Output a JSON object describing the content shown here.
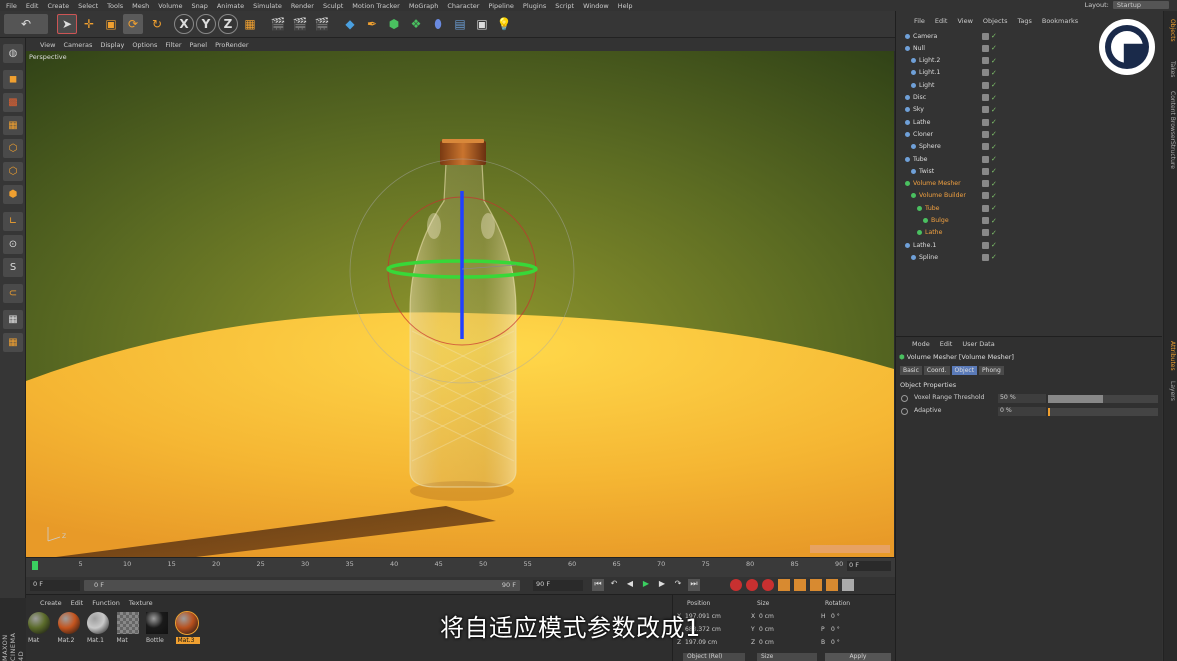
{
  "menubar": {
    "items": [
      "File",
      "Edit",
      "Create",
      "Select",
      "Tools",
      "Mesh",
      "Volume",
      "Snap",
      "Animate",
      "Simulate",
      "Render",
      "Sculpt",
      "Motion Tracker",
      "MoGraph",
      "Character",
      "Pipeline",
      "Plugins",
      "Script",
      "Window",
      "Help"
    ],
    "layout_label": "Layout:",
    "layout_value": "Startup"
  },
  "viewport": {
    "menu": [
      "View",
      "Cameras",
      "Display",
      "Options",
      "Filter",
      "Panel",
      "ProRender"
    ],
    "label": "Perspective",
    "axis_z": "Z"
  },
  "timeline": {
    "ticks": [
      "0",
      "5",
      "10",
      "15",
      "20",
      "25",
      "30",
      "35",
      "40",
      "45",
      "50",
      "55",
      "60",
      "65",
      "70",
      "75",
      "80",
      "85",
      "90"
    ],
    "end_frame": "0 F",
    "current": "0 F",
    "start_field": "0 F",
    "range_end": "90 F",
    "max_field": "90 F"
  },
  "materials": {
    "menu": [
      "Create",
      "Edit",
      "Function",
      "Texture"
    ],
    "items": [
      {
        "label": "Mat",
        "color": "#5b6b2a"
      },
      {
        "label": "Mat.2",
        "color": "#c4541e"
      },
      {
        "label": "Mat.1",
        "color": "#c9c9c9"
      },
      {
        "label": "Mat",
        "color": "#7a7a7a"
      },
      {
        "label": "Bottle",
        "color": "#1a1a1a"
      },
      {
        "label": "Mat.3",
        "color": "#b8501d"
      }
    ]
  },
  "coordinates": {
    "headers": [
      "Position",
      "Size",
      "Rotation"
    ],
    "rows": [
      {
        "axis": "X",
        "pos": "197.091 cm",
        "size_axis": "X",
        "size": "0 cm",
        "rot_axis": "H",
        "rot": "0 °"
      },
      {
        "axis": "Y",
        "pos": "683.372 cm",
        "size_axis": "Y",
        "size": "0 cm",
        "rot_axis": "P",
        "rot": "0 °"
      },
      {
        "axis": "Z",
        "pos": "197.09 cm",
        "size_axis": "Z",
        "size": "0 cm",
        "rot_axis": "B",
        "rot": "0 °"
      }
    ],
    "mode_select": "Object (Rel)",
    "size_select": "Size",
    "apply": "Apply"
  },
  "objects": {
    "menu": [
      "File",
      "Edit",
      "View",
      "Objects",
      "Tags",
      "Bookmarks"
    ],
    "tree": [
      {
        "name": "Camera",
        "indent": 0,
        "color": "#ddd"
      },
      {
        "name": "Null",
        "indent": 0,
        "color": "#ddd"
      },
      {
        "name": "Light.2",
        "indent": 1,
        "color": "#ddd"
      },
      {
        "name": "Light.1",
        "indent": 1,
        "color": "#ddd"
      },
      {
        "name": "Light",
        "indent": 1,
        "color": "#ddd"
      },
      {
        "name": "Disc",
        "indent": 0,
        "color": "#ddd"
      },
      {
        "name": "Sky",
        "indent": 0,
        "color": "#ddd"
      },
      {
        "name": "Lathe",
        "indent": 0,
        "color": "#ddd"
      },
      {
        "name": "Cloner",
        "indent": 0,
        "color": "#ddd"
      },
      {
        "name": "Sphere",
        "indent": 1,
        "color": "#ddd"
      },
      {
        "name": "Tube",
        "indent": 0,
        "color": "#ddd"
      },
      {
        "name": "Twist",
        "indent": 1,
        "color": "#ddd"
      },
      {
        "name": "Volume Mesher",
        "indent": 0,
        "color": "#f0a040"
      },
      {
        "name": "Volume Builder",
        "indent": 1,
        "color": "#f0a040"
      },
      {
        "name": "Tube",
        "indent": 2,
        "color": "#f0a040"
      },
      {
        "name": "Bulge",
        "indent": 3,
        "color": "#f0a040"
      },
      {
        "name": "Lathe",
        "indent": 2,
        "color": "#f0a040"
      },
      {
        "name": "Lathe.1",
        "indent": 0,
        "color": "#ddd"
      },
      {
        "name": "Spline",
        "indent": 1,
        "color": "#ddd"
      }
    ]
  },
  "sidetabs": [
    "Objects",
    "Takes",
    "Content Browser",
    "Structure",
    "Attributes",
    "Layers"
  ],
  "attributes": {
    "menu": [
      "Mode",
      "Edit",
      "User Data"
    ],
    "title": "Volume Mesher [Volume Mesher]",
    "tabs": [
      "Basic",
      "Coord.",
      "Object",
      "Phong"
    ],
    "active_tab": "Object",
    "section": "Object Properties",
    "params": [
      {
        "label": "Voxel Range Threshold",
        "value": "50 %",
        "fraction": 0.5
      },
      {
        "label": "Adaptive",
        "value": "0 %",
        "fraction": 0.0
      }
    ]
  },
  "subtitle": "将自适应模式参数改成1",
  "brand": "MAXON CINEMA 4D"
}
